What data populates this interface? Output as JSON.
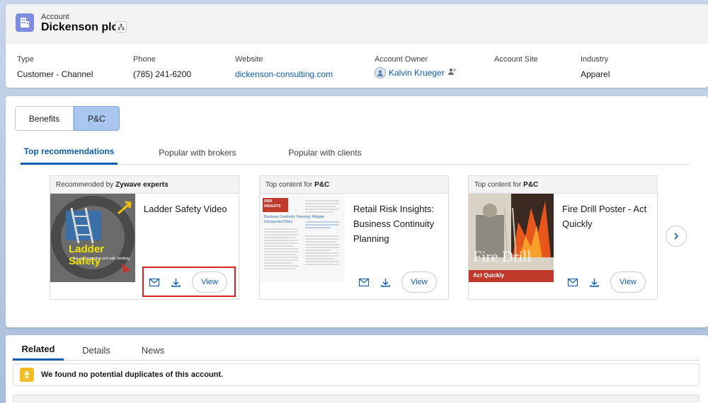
{
  "header": {
    "object_label": "Account",
    "account_name": "Dickenson plc",
    "fields": [
      {
        "label": "Type",
        "value": "Customer - Channel"
      },
      {
        "label": "Phone",
        "value": "(785) 241-6200"
      },
      {
        "label": "Website",
        "value": "dickenson-consulting.com"
      },
      {
        "label": "Account Owner",
        "value": "Kalvin Krueger"
      },
      {
        "label": "Account Site",
        "value": ""
      },
      {
        "label": "Industry",
        "value": "Apparel"
      }
    ],
    "icons": {
      "account": "building-icon",
      "hierarchy": "hierarchy-icon",
      "owner": "avatar-icon",
      "change_owner": "change-owner-icon"
    }
  },
  "toggle": {
    "benefits": "Benefits",
    "pc": "P&C",
    "active": "P&C"
  },
  "tabs": [
    "Top recommendations",
    "Popular with brokers",
    "Popular with clients"
  ],
  "active_tab": "Top recommendations",
  "cards": [
    {
      "head_prefix": "Recommended by",
      "head_bold": "Zywave experts",
      "title": "Ladder Safety Video",
      "thumb_text": "Ladder Safety",
      "thumb_sub": "Set up, inspection and safe climbing",
      "view_label": "View"
    },
    {
      "head_prefix": "Top content for",
      "head_bold": "P&C",
      "title": "Retail Risk Insights: Business Continuity Planning",
      "thumb_text": "RISK INSIGHTS",
      "thumb_sub": "Business Continuity Planning: Mitigate Unexpected Risks",
      "view_label": "View"
    },
    {
      "head_prefix": "Top content for",
      "head_bold": "P&C",
      "title": "Fire Drill Poster - Act Quickly",
      "thumb_text": "Fire Drill",
      "thumb_sub": "Act Quickly",
      "view_label": "View"
    }
  ],
  "related": {
    "tabs": [
      "Related",
      "Details",
      "News"
    ],
    "active": "Related",
    "duplicate_message": "We found no potential duplicates of this account."
  },
  "colors": {
    "brand_blue": "#0b5cab",
    "highlight_red": "#e0201e",
    "toggle_active": "#a8c6ef",
    "account_icon": "#7f8de1",
    "duplicate_icon": "#f4bc25"
  }
}
